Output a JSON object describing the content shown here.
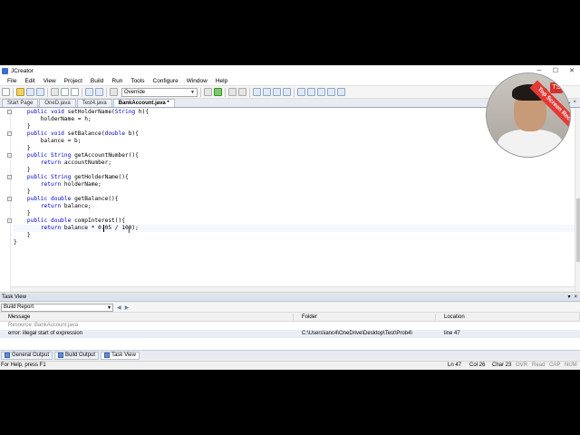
{
  "window": {
    "title": "JCreator",
    "controls": [
      "─",
      "☐",
      "✕"
    ]
  },
  "menu": [
    "File",
    "Edit",
    "View",
    "Project",
    "Build",
    "Run",
    "Tools",
    "Configure",
    "Window",
    "Help"
  ],
  "toolbar": {
    "mode_select": "Override"
  },
  "tabs": [
    {
      "label": "Start Page",
      "active": false
    },
    {
      "label": "OneD.java",
      "active": false
    },
    {
      "label": "Test4.java",
      "active": false
    },
    {
      "label": "BankAccount.java *",
      "active": true
    }
  ],
  "editor": {
    "lines": [
      "    public void setHolderName(String h){",
      "        holderName = h;",
      "    }",
      "    public void setBalance(double b){",
      "        balance = b;",
      "    }",
      "    public String getAccountNumber(){",
      "        return accountNumber;",
      "    }",
      "    public String getHolderName(){",
      "        return holderName;",
      "    }",
      "    public double getBalance(){",
      "        return balance;",
      "    }",
      "    public double compInterest(){",
      "        return balance * 0.05 / 100);",
      "    }",
      "}"
    ]
  },
  "task_view": {
    "title": "Task View",
    "controls": [
      "▾",
      "×"
    ],
    "report_select": "Build Report",
    "columns": [
      "Message",
      "Folder",
      "Location"
    ],
    "group_label": "Resource: BankAccount.java",
    "rows": [
      {
        "message": "error: illegal start of expression",
        "folder": "C:\\Users\\ianc4\\OneDrive\\Desktop\\Test\\Prob4\\",
        "location": "line 47"
      }
    ]
  },
  "bottom_tabs": [
    "General Output",
    "Build Output",
    "Task View"
  ],
  "status": {
    "help": "For Help, press F1",
    "ln": "Ln 47",
    "col": "Col 26",
    "char": "Char 23",
    "ovr": "OVR",
    "read": "Read",
    "cap": "CAP",
    "num": "NUM"
  },
  "webcam": {
    "banner": "Top Screen Recorder",
    "badge": "TS"
  }
}
